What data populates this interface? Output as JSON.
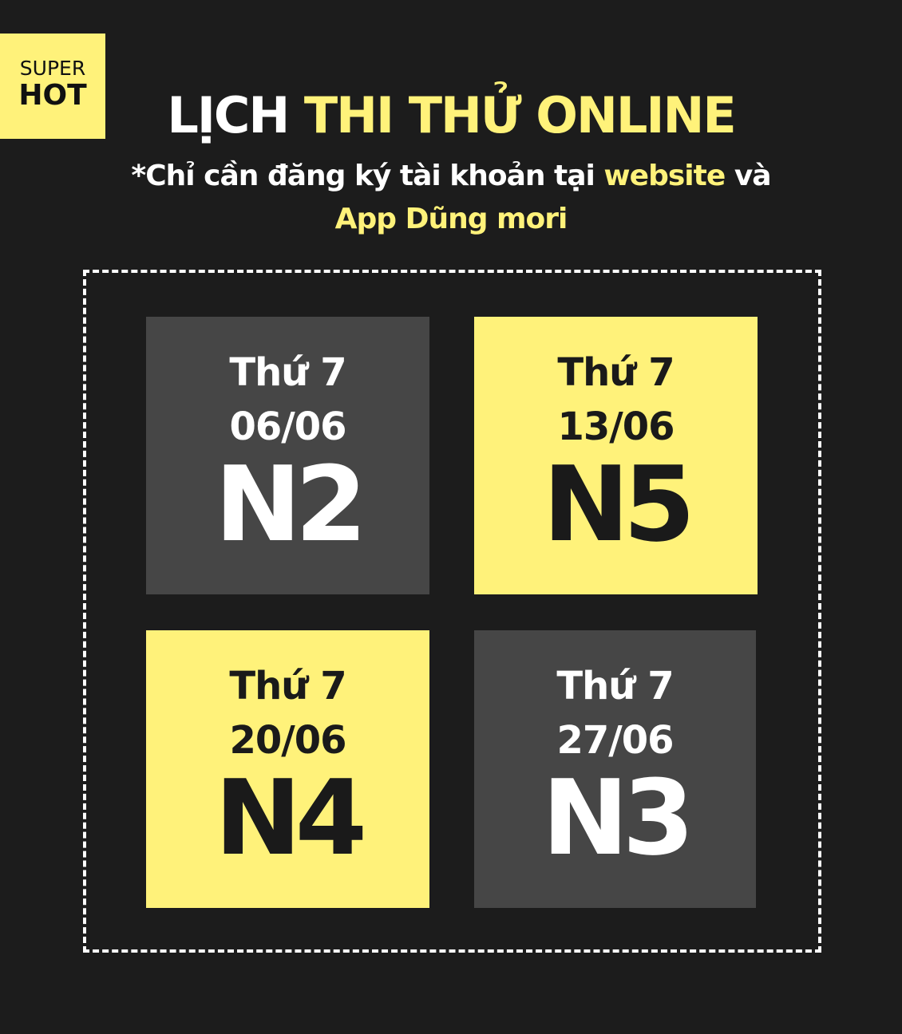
{
  "badge": {
    "top": "SUPER",
    "bottom": "HOT"
  },
  "title": {
    "part1": "LỊCH",
    "part2": "THI THỬ ONLINE"
  },
  "subtitle": {
    "text1": "*Chỉ cần đăng ký tài khoản tại",
    "highlight1": "website",
    "text2": "và",
    "highlight2": "App Dũng mori"
  },
  "cards": [
    {
      "day": "Thứ 7",
      "date": "06/06",
      "level": "N2",
      "style": "gray"
    },
    {
      "day": "Thứ 7",
      "date": "13/06",
      "level": "N5",
      "style": "yellow"
    },
    {
      "day": "Thứ 7",
      "date": "20/06",
      "level": "N4",
      "style": "yellow"
    },
    {
      "day": "Thứ 7",
      "date": "27/06",
      "level": "N3",
      "style": "gray"
    }
  ],
  "colors": {
    "background": "#1c1c1c",
    "accent": "#fff27a",
    "card_gray": "#464646"
  }
}
